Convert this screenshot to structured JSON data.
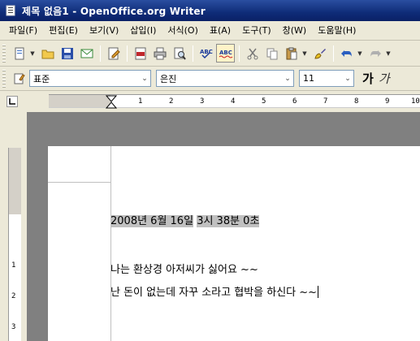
{
  "window": {
    "title": "제목 없음1 - OpenOffice.org Writer"
  },
  "menu": [
    "파일(F)",
    "편집(E)",
    "보기(V)",
    "삽입(I)",
    "서식(O)",
    "표(A)",
    "도구(T)",
    "창(W)",
    "도움말(H)"
  ],
  "toolbar": {
    "icons": [
      "new-document-icon",
      "open-folder-icon",
      "save-icon",
      "email-icon",
      "edit-file-icon",
      "export-pdf-icon",
      "print-icon",
      "page-preview-icon",
      "spellcheck-icon",
      "autospellcheck-icon",
      "cut-icon",
      "copy-icon",
      "paste-icon",
      "format-paintbrush-icon",
      "undo-icon",
      "redo-icon"
    ]
  },
  "formatting": {
    "paragraph_style": "표준",
    "font_name": "은진",
    "font_size": "11",
    "bold_glyph": "가",
    "italic_glyph": "가"
  },
  "ruler": {
    "h_ticks": [
      "1",
      "2",
      "3",
      "4",
      "5",
      "6",
      "7",
      "8",
      "9",
      "10"
    ],
    "v_ticks": [
      "1",
      "2",
      "3"
    ]
  },
  "document": {
    "lines": [
      {
        "segments": [
          {
            "text": "2008년 6월 16일",
            "highlight": true
          },
          {
            "text": " ",
            "highlight": false
          },
          {
            "text": "3시 38분 0초",
            "highlight": true
          }
        ]
      },
      {
        "segments": [
          {
            "text": "나는 환상경 아저씨가 싫어요 ~~",
            "highlight": false
          }
        ]
      },
      {
        "segments": [
          {
            "text": "난 돈이 없는데 자꾸 소라고 협박을 하신다 ~~",
            "highlight": false
          }
        ]
      }
    ]
  },
  "colors": {
    "titlebar": "#0f2c78",
    "chrome": "#ece9d8",
    "canvas": "#808080",
    "highlight": "#c0c0c0"
  }
}
